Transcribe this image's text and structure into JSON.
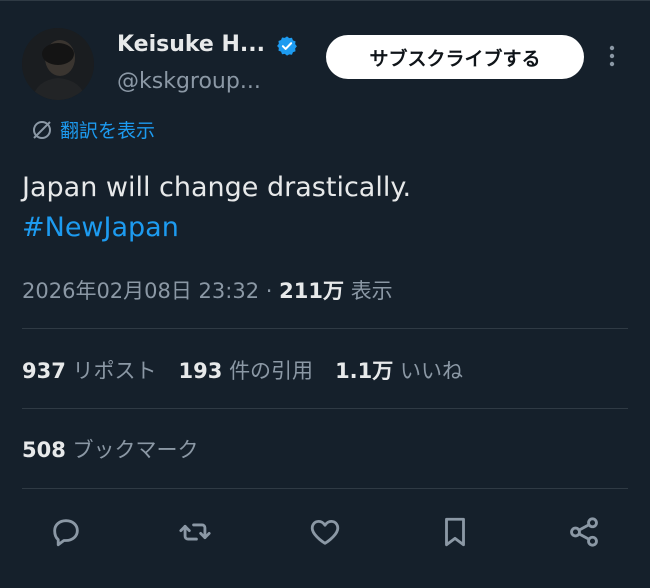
{
  "author": {
    "display_name": "Keisuke H...",
    "handle": "@kskgroup..."
  },
  "header": {
    "subscribe_label": "サブスクライブする"
  },
  "translate": {
    "label": "翻訳を表示"
  },
  "tweet": {
    "text_line1": "Japan will change drastically.",
    "hashtag": "#NewJapan"
  },
  "meta": {
    "timestamp": "2026年02月08日 23:32",
    "separator": "·",
    "views_count": "211万",
    "views_label": "表示"
  },
  "stats": {
    "reposts_count": "937",
    "reposts_label": "リポスト",
    "quotes_count": "193",
    "quotes_label": "件の引用",
    "likes_count": "1.1万",
    "likes_label": "いいね",
    "bookmarks_count": "508",
    "bookmarks_label": "ブックマーク"
  },
  "icons": {
    "verified": "verified-badge-icon",
    "more": "more-vertical-icon",
    "translate": "translate-icon",
    "reply": "reply-icon",
    "repost": "repost-icon",
    "like": "heart-icon",
    "bookmark": "bookmark-icon",
    "share": "share-icon"
  },
  "colors": {
    "background": "#15202b",
    "accent": "#1d9bf0",
    "text": "#e7e9ea",
    "muted": "#8b98a5"
  }
}
